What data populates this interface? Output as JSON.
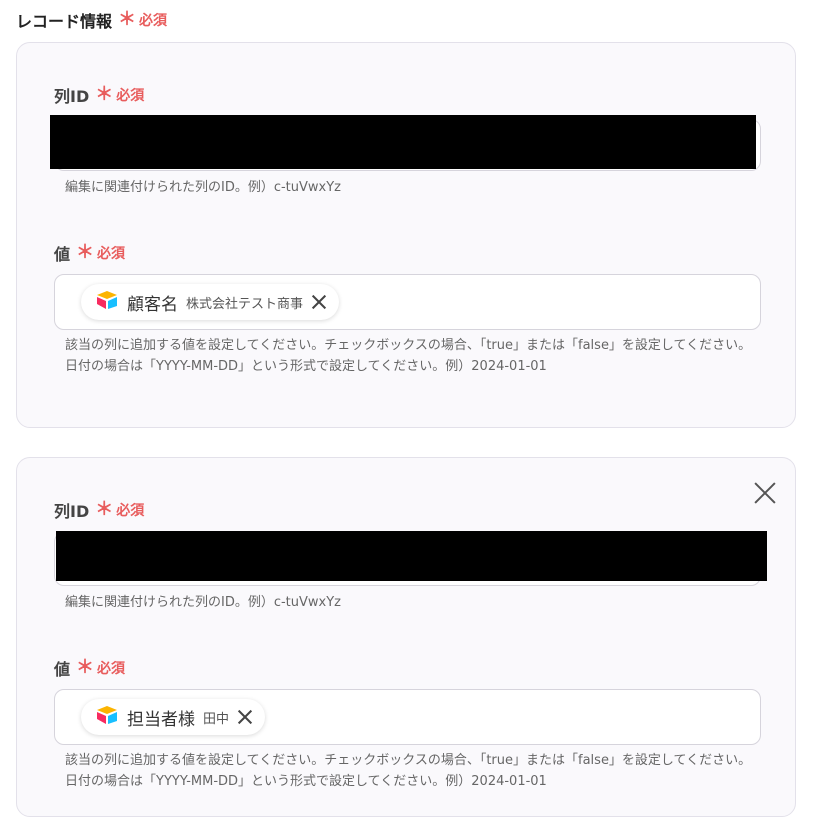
{
  "section": {
    "title": "レコード情報",
    "required_mark": "＊",
    "required_label": "必須"
  },
  "records": [
    {
      "column_id_label": "列ID",
      "required_label": "必須",
      "column_id_value": "",
      "column_id_hint": "編集に関連付けられた列のID。例）c-tuVwxYz",
      "value_label": "値",
      "value_required_label": "必須",
      "chip_name": "顧客名",
      "chip_value": "株式会社テスト商事",
      "value_hint_line1": "該当の列に追加する値を設定してください。チェックボックスの場合、「true」または「false」を設定してください。",
      "value_hint_line2": "日付の場合は「YYYY-MM-DD」という形式で設定してください。例）2024-01-01"
    },
    {
      "column_id_label": "列ID",
      "required_label": "必須",
      "column_id_value": "",
      "column_id_hint": "編集に関連付けられた列のID。例）c-tuVwxYz",
      "value_label": "値",
      "value_required_label": "必須",
      "chip_name": "担当者様",
      "chip_value": "田中",
      "value_hint_line1": "該当の列に追加する値を設定してください。チェックボックスの場合、「true」または「false」を設定してください。",
      "value_hint_line2": "日付の場合は「YYYY-MM-DD」という形式で設定してください。例）2024-01-01"
    }
  ],
  "icons": {
    "chip_icon": "airtable-logo-icon",
    "remove": "close-icon",
    "remove_card": "close-icon"
  },
  "colors": {
    "required": "#e85d5d",
    "card_bg": "#faf9fc"
  }
}
